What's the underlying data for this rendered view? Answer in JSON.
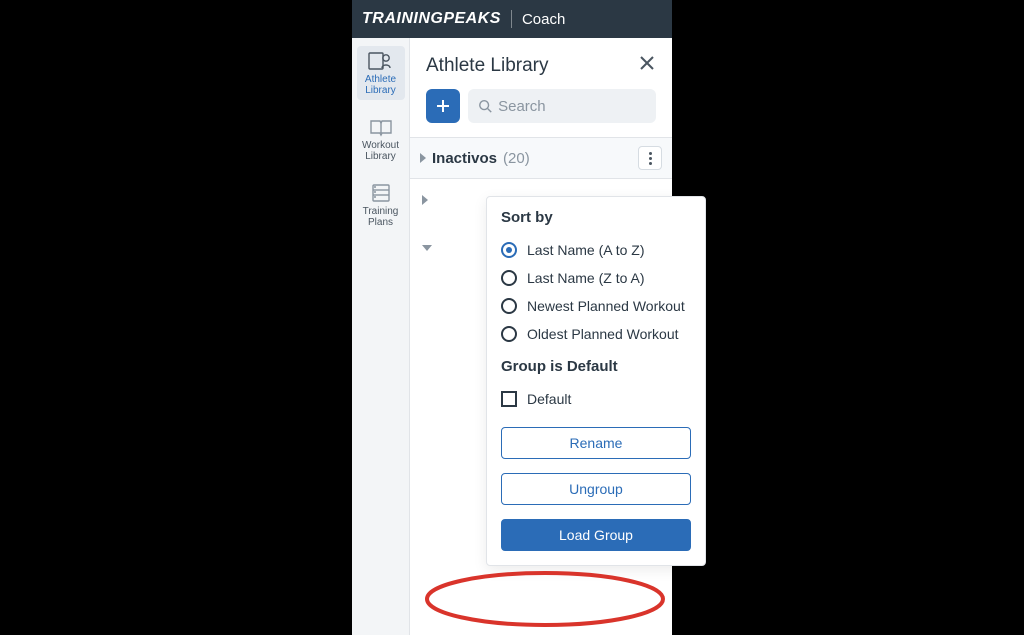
{
  "header": {
    "brand": "TRAININGPEAKS",
    "sub": "Coach"
  },
  "sidebar": {
    "items": [
      {
        "label": "Athlete Library",
        "active": true
      },
      {
        "label": "Workout Library",
        "active": false
      },
      {
        "label": "Training Plans",
        "active": false
      }
    ]
  },
  "panel": {
    "title": "Athlete Library",
    "search_placeholder": "Search",
    "group": {
      "name": "Inactivos",
      "count": "(20)"
    }
  },
  "popover": {
    "sort_title": "Sort by",
    "sort_options": [
      {
        "label": "Last Name (A to Z)",
        "selected": true
      },
      {
        "label": "Last Name (Z to A)",
        "selected": false
      },
      {
        "label": "Newest Planned Workout",
        "selected": false
      },
      {
        "label": "Oldest Planned Workout",
        "selected": false
      }
    ],
    "default_title": "Group is Default",
    "default_label": "Default",
    "btn_rename": "Rename",
    "btn_ungroup": "Ungroup",
    "btn_load": "Load Group"
  }
}
